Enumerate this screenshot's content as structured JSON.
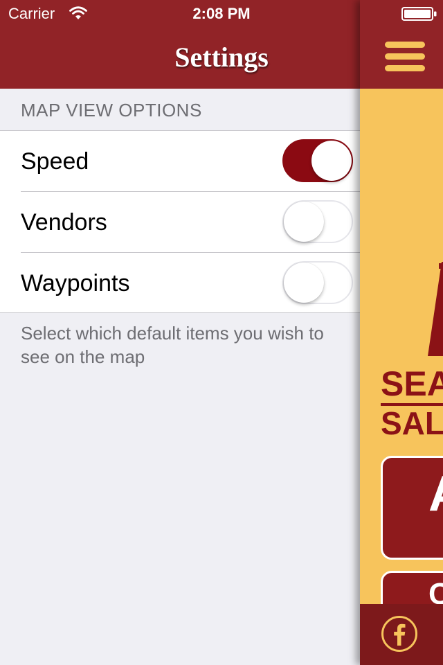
{
  "status_bar": {
    "carrier": "Carrier",
    "time": "2:08 PM",
    "wifi_icon": "wifi-icon",
    "battery_icon": "battery-icon"
  },
  "nav": {
    "title": "Settings"
  },
  "section": {
    "header": "MAP VIEW OPTIONS",
    "items": [
      {
        "label": "Speed",
        "enabled": true
      },
      {
        "label": "Vendors",
        "enabled": false
      },
      {
        "label": "Waypoints",
        "enabled": false
      }
    ],
    "footer": "Select which default items you wish to see on the map"
  },
  "main_panel": {
    "menu_icon": "hamburger-menu-icon",
    "logo_line1": "SEA",
    "logo_line2": "SAL",
    "card1_text": "A",
    "card2_text": "C",
    "facebook_icon": "facebook-icon"
  },
  "colors": {
    "brand_red": "#912327",
    "toggle_on": "#8b0a12",
    "brand_gold": "#f7c45c",
    "background": "#efeff4"
  }
}
